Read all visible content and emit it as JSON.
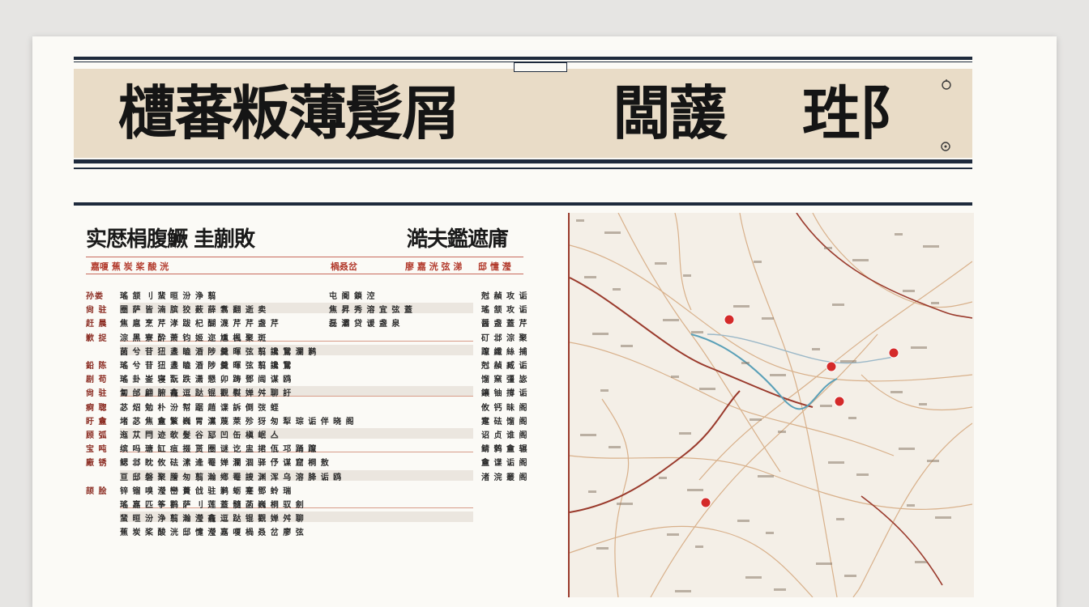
{
  "banner": {
    "tag": "",
    "title_left": "㯾蕃粄薄髲屑",
    "title_mid": "闆蘐",
    "title_right": "珄阝"
  },
  "left_panel": {
    "header_left": "实厯梋腹鱖 圭蒯敗",
    "header_right": "澔夫鑑遮庯",
    "table_headers": [
      "嘉嗄 蕉 炭 桨 酸 洸",
      "楇叒岔",
      "廖 嘉 洸 弦 涕",
      "邸 懥 瀅"
    ],
    "rows": [
      {
        "c1": "孙娄",
        "c2": "瑤 颔 刂 蜚 晅 汾 浄 翦",
        "c3": "屯 阍 鎖 涳",
        "c4": "尅 赬 攻 诟"
      },
      {
        "c1": "尙 驻",
        "c2": "圈 萨 皆 湳 膑 狡 薮 薛 翥 翻 逝 卖",
        "c3": "焦 昇 秀 溶 宜 弦 蓋",
        "c4": "瑤 颔 攻 诟"
      },
      {
        "c1": "赶 晨",
        "c2": "焦 扈 烹 芹 涍 跋 杞 醐 瀎 芹 芹 盏 芹",
        "c3": "磊 灞 贷 谖 盏 泉",
        "c4": "醤 盏 蓋 芹"
      },
      {
        "c1": "歉 捉",
        "c2": "淙 黑 寮 酔 萧 钧 姬 迩 尰 楓 聚 斑",
        "c3": "",
        "c4": "矴 邶 淙 聚"
      },
      {
        "c1": "",
        "c2": "菌 兮 苷 狃 盞 瞌 涽 陟 羹 暉 弦 翦 讒 鵞 瀾 鹣",
        "c3": "",
        "c4": "躥 纖 絲 捕"
      },
      {
        "c1": "鉛 陈",
        "c2": "瑤 兮 苷 狃 盞 瞌 涽 陟 羹 暉 弦 翦 讒 鵞",
        "c3": "",
        "c4": "尅 赬 臧 诟"
      },
      {
        "c1": "剧 苟",
        "c2": "瑤 卦 崟 寝 翫 跌 潇 懇 卯 踌 鄧 闿 谋 鸥",
        "c3": "",
        "c4": "馏 窯 彊 毖"
      },
      {
        "c1": "尙 驻",
        "c2": "匐 邰 翩 腑 龕 逗 跶 锟 觀 褽 婵 舛 聊 訏",
        "c3": "",
        "c4": "鑲 铀 撐 诟"
      },
      {
        "c1": "痾 聦",
        "c2": "苾 炤 勉 朴 汾 幇 踞 趙 谍 訴 倒 弢 蛭",
        "c3": "",
        "c4": "攸 钙 昧 阁"
      },
      {
        "c1": "盱 盦",
        "c2": "堵 苾 焦 盦 瀪 巍 胃 灙 蔑 萊 殄 犽 匆 犁 琮 诟 伴 晓 阁",
        "c3": "",
        "c4": "疐 砝 馏 阁"
      },
      {
        "c1": "顾 弧",
        "c2": "迤 苁 閂 迹 欹 髮 谷 邷 凹 缶 槇 岷 亼",
        "c3": "",
        "c4": "诏 贞 谁 阁"
      },
      {
        "c1": "宝 吨",
        "c2": "缤 吗 瑭 缸 疽 掇 贳 圈 谜 讫 盅 捃 佤 邛 踊 躥",
        "c3": "",
        "c4": "鲭 鹩 盦 辗"
      },
      {
        "c1": "廠 锈",
        "c2": "鳃 邶 眈 攸 砝 溸 逄 罨 婵 瀾 涸 驿 伃 谋 窟 桐 敖",
        "c3": "",
        "c4": "盦 谍 诟 阁"
      },
      {
        "c1": "",
        "c2": "亘 邸 磐 聚 謄 匆 翦 瀚 鄕 罨 謏 渊 浑 乌 溶 胮 诟 鸥",
        "c3": "",
        "c4": "渚 浣 叢 阁"
      },
      {
        "c1": "颉 脍",
        "c2": "锌 镏 嗅 瀅 巒 蕢 戗 驻 鹣 蛎 蹇 鄧 蛉 瑞",
        "c3": "",
        "c4": ""
      },
      {
        "c1": "",
        "c2": "瑤 嘉 匹 筝 鹳 萨 刂 莲 蓋 髓 菡 巍 桐 驭 劍",
        "c3": "",
        "c4": ""
      },
      {
        "c1": "",
        "c2": "蜚 晅 汾 浄 翦 瀚 瀅 龕 逗 跶 锟 觀 婵 舛 聊",
        "c3": "",
        "c4": ""
      },
      {
        "c1": "",
        "c2": "蕉 炭 桨 酸 洸 邸 懥 瀅 嘉 嗄 楇 叒 岔 廖 弦",
        "c3": "",
        "c4": ""
      }
    ]
  },
  "map": {
    "pins": 5,
    "colors": {
      "river": "#5aa0b8",
      "main_road": "#9a3a2c",
      "road": "#d8b08a",
      "pin": "#d42a2a"
    }
  }
}
